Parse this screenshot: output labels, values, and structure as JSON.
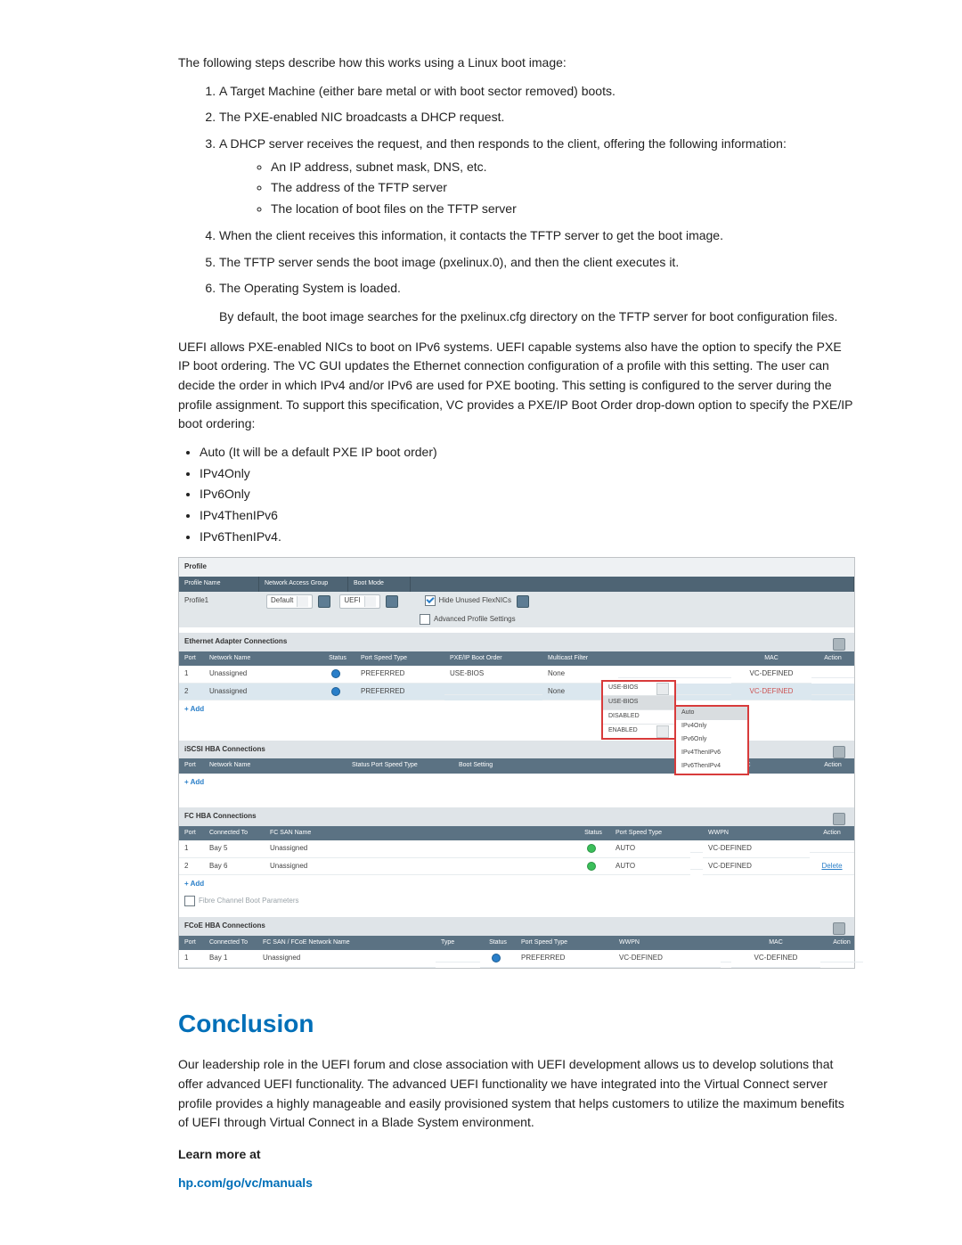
{
  "intro": "The following steps describe how this works using a Linux boot image:",
  "steps": [
    {
      "text": "A Target Machine (either bare metal or with boot sector removed) boots."
    },
    {
      "text": "The PXE-enabled NIC broadcasts a DHCP request."
    },
    {
      "text": "A DHCP server receives the request, and then responds to the client, offering the following information:",
      "sub": [
        "An IP address, subnet mask, DNS, etc.",
        "The address of the TFTP server",
        "The location of boot files on the TFTP server"
      ]
    },
    {
      "text": "When the client receives this information, it contacts the TFTP server to get the boot image."
    },
    {
      "text": "The TFTP server sends the boot image (pxelinux.0), and then the client executes it."
    },
    {
      "text": "The Operating System is loaded."
    }
  ],
  "note_after_steps": "By default, the boot image searches for the pxelinux.cfg directory on the TFTP server for boot configuration files.",
  "uefi_para": "UEFI allows PXE-enabled NICs to boot on IPv6 systems. UEFI capable systems also have the option to specify the PXE IP boot ordering. The VC GUI updates the Ethernet connection configuration of a profile with this setting. The user can decide the order in which IPv4 and/or IPv6 are used for PXE booting. This setting is configured to the server during the profile assignment. To support this specification, VC provides a PXE/IP Boot Order drop-down option to specify the PXE/IP boot ordering:",
  "boot_order_options": [
    "Auto (It will be a default PXE IP boot order)",
    "IPv4Only",
    "IPv6Only",
    "IPv4ThenIPv6",
    "IPv6ThenIPv4."
  ],
  "shot": {
    "profile": {
      "title": "Profile",
      "col_profile_name": "Profile Name",
      "col_nag": "Network Access Group",
      "col_boot_mode": "Boot Mode",
      "profile_value": "Profile1",
      "nag_value": "Default",
      "boot_mode_value": "UEFI",
      "hide_unused_label": "Hide Unused FlexNICs",
      "adv_settings_label": "Advanced Profile Settings"
    },
    "eth": {
      "title": "Ethernet Adapter Connections",
      "headers": {
        "port": "Port",
        "net": "Network Name",
        "status": "Status",
        "pst": "Port Speed Type",
        "pxe": "PXE/IP Boot Order",
        "mcast": "Multicast Filter",
        "mac": "MAC",
        "action": "Action"
      },
      "rows": [
        {
          "idx": "1",
          "net": "Unassigned",
          "pst": "PREFERRED",
          "pxe": "USE-BIOS",
          "mcast": "None",
          "mac": "VC-DEFINED"
        },
        {
          "idx": "2",
          "net": "Unassigned",
          "pst": "PREFERRED",
          "pxe": "USE-BIOS",
          "mcast": "None",
          "mac": "VC-DEFINED"
        }
      ],
      "add_label": "+ Add",
      "pxe_dropdown": [
        "USE-BIOS",
        "USE-BIOS",
        "DISABLED",
        "ENABLED"
      ],
      "ip_dropdown": [
        "Auto",
        "IPv4Only",
        "IPv6Only",
        "IPv4ThenIPv6",
        "IPv6ThenIPv4"
      ]
    },
    "iscsi": {
      "title": "iSCSI HBA Connections",
      "headers": {
        "port": "Port",
        "net": "Network Name",
        "status_pst": "Status   Port Speed Type",
        "boot": "Boot Setting",
        "mac": "MAC",
        "action": "Action"
      },
      "add_label": "+ Add"
    },
    "fc": {
      "title": "FC HBA Connections",
      "headers": {
        "port": "Port",
        "conn": "Connected To",
        "san": "FC SAN Name",
        "status": "Status",
        "pst": "Port Speed Type",
        "wwpn": "WWPN",
        "action": "Action"
      },
      "rows": [
        {
          "idx": "1",
          "conn": "Bay 5",
          "san": "Unassigned",
          "pst": "AUTO",
          "wwpn": "VC-DEFINED",
          "action": ""
        },
        {
          "idx": "2",
          "conn": "Bay 6",
          "san": "Unassigned",
          "pst": "AUTO",
          "wwpn": "VC-DEFINED",
          "action": "Delete"
        }
      ],
      "add_label": "+ Add",
      "fc_boot_params_label": "Fibre Channel Boot Parameters"
    },
    "fcoe": {
      "title": "FCoE HBA Connections",
      "headers": {
        "port": "Port",
        "conn": "Connected To",
        "net": "FC SAN / FCoE Network Name",
        "type": "Type",
        "status": "Status",
        "pst": "Port Speed Type",
        "wwpn": "WWPN",
        "mac": "MAC",
        "action": "Action"
      },
      "rows": [
        {
          "idx": "1",
          "conn": "Bay 1",
          "net": "Unassigned",
          "type": "",
          "pst": "PREFERRED",
          "wwpn": "VC-DEFINED",
          "mac": "VC-DEFINED"
        }
      ]
    }
  },
  "conclusion_heading": "Conclusion",
  "conclusion_body": "Our leadership role in the UEFI forum and close association with UEFI development allows us to develop solutions that offer advanced UEFI functionality. The advanced UEFI functionality we have integrated into the Virtual Connect server profile provides a highly manageable and easily provisioned system that helps customers to utilize the maximum benefits of UEFI through Virtual Connect in a Blade System environment.",
  "learn_more": "Learn more at",
  "learn_link_text": "hp.com/go/vc/manuals"
}
